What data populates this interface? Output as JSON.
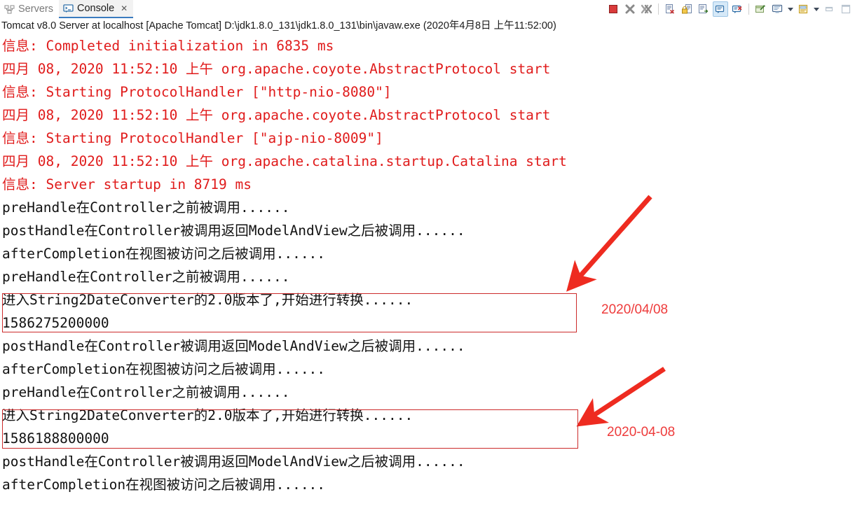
{
  "window": {
    "tabs": [
      {
        "label": "Servers",
        "icon": "servers-icon",
        "active": false,
        "closable": false
      },
      {
        "label": "Console",
        "icon": "console-icon",
        "active": true,
        "closable": true,
        "close_glyph": "✕"
      }
    ]
  },
  "toolbar": {
    "buttons": [
      {
        "name": "terminate-button",
        "icon": "stop-square-icon"
      },
      {
        "name": "remove-launch-button",
        "icon": "remove-x-icon"
      },
      {
        "name": "remove-all-terminated-button",
        "icon": "remove-all-xx-icon"
      },
      {
        "name": "clear-console-button",
        "icon": "clear-console-icon"
      },
      {
        "name": "scroll-lock-button",
        "icon": "lock-icon"
      },
      {
        "name": "word-wrap-button",
        "icon": "word-wrap-icon"
      },
      {
        "name": "show-console-on-output-button",
        "icon": "show-console-icon",
        "selected": true
      },
      {
        "name": "show-console-on-error-button",
        "icon": "show-console-error-icon"
      },
      {
        "name": "pin-console-button",
        "icon": "pin-console-icon"
      },
      {
        "name": "display-selected-console-button",
        "icon": "display-console-icon"
      },
      {
        "name": "display-selected-console-dropdown",
        "icon": "chevron-down-icon"
      },
      {
        "name": "open-console-button",
        "icon": "open-console-icon"
      },
      {
        "name": "open-console-dropdown",
        "icon": "chevron-down-icon"
      },
      {
        "name": "minimize-view-button",
        "icon": "minimize-icon"
      },
      {
        "name": "maximize-view-button",
        "icon": "maximize-icon"
      }
    ]
  },
  "console": {
    "process_header": "Tomcat v8.0 Server at localhost [Apache Tomcat] D:\\jdk1.8.0_131\\jdk1.8.0_131\\bin\\javaw.exe (2020年4月8日 上午11:52:00)",
    "lines": [
      {
        "stream": "err",
        "text": "信息: Completed initialization in 6835 ms"
      },
      {
        "stream": "err",
        "text": "四月 08, 2020 11:52:10 上午 org.apache.coyote.AbstractProtocol start"
      },
      {
        "stream": "err",
        "text": "信息: Starting ProtocolHandler [\"http-nio-8080\"]"
      },
      {
        "stream": "err",
        "text": "四月 08, 2020 11:52:10 上午 org.apache.coyote.AbstractProtocol start"
      },
      {
        "stream": "err",
        "text": "信息: Starting ProtocolHandler [\"ajp-nio-8009\"]"
      },
      {
        "stream": "err",
        "text": "四月 08, 2020 11:52:10 上午 org.apache.catalina.startup.Catalina start"
      },
      {
        "stream": "err",
        "text": "信息: Server startup in 8719 ms"
      },
      {
        "stream": "out",
        "text": "preHandle在Controller之前被调用......"
      },
      {
        "stream": "out",
        "text": "postHandle在Controller被调用返回ModelAndView之后被调用......"
      },
      {
        "stream": "out",
        "text": "afterCompletion在视图被访问之后被调用......"
      },
      {
        "stream": "out",
        "text": "preHandle在Controller之前被调用......"
      },
      {
        "stream": "out",
        "text": "进入String2DateConverter的2.0版本了,开始进行转换......"
      },
      {
        "stream": "out",
        "text": "1586275200000"
      },
      {
        "stream": "out",
        "text": "postHandle在Controller被调用返回ModelAndView之后被调用......"
      },
      {
        "stream": "out",
        "text": "afterCompletion在视图被访问之后被调用......"
      },
      {
        "stream": "out",
        "text": "preHandle在Controller之前被调用......"
      },
      {
        "stream": "out",
        "text": "进入String2DateConverter的2.0版本了,开始进行转换......"
      },
      {
        "stream": "out",
        "text": "1586188800000"
      },
      {
        "stream": "out",
        "text": "postHandle在Controller被调用返回ModelAndView之后被调用......"
      },
      {
        "stream": "out",
        "text": "afterCompletion在视图被访问之后被调用......"
      }
    ]
  },
  "annotations": {
    "color": "#ee3b3b",
    "box_color": "#cc2b2b",
    "labels": [
      {
        "name": "annotation-date-slash",
        "text": "2020/04/08"
      },
      {
        "name": "annotation-date-dash",
        "text": "2020-04-08"
      }
    ]
  }
}
